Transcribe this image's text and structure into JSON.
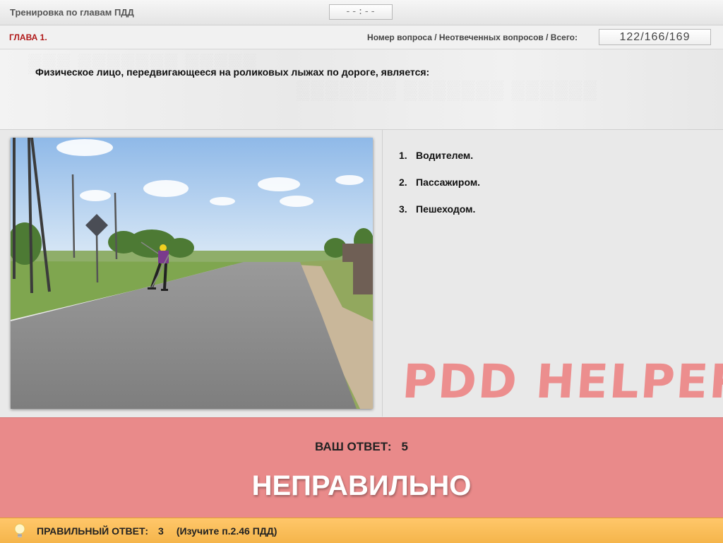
{
  "header": {
    "app_title": "Тренировка по главам ПДД",
    "timer": "--:--"
  },
  "chapter_bar": {
    "chapter": "ГЛАВА 1.",
    "counter_label": "Номер вопроса / Неотвеченных вопросов / Всего:",
    "counter_value": "122/166/169"
  },
  "question": {
    "text": "Физическое лицо, передвигающееся на роликовых лыжах по дороге, является:"
  },
  "answers": [
    {
      "num": "1.",
      "text": "Водителем."
    },
    {
      "num": "2.",
      "text": "Пассажиром."
    },
    {
      "num": "3.",
      "text": "Пешеходом."
    }
  ],
  "watermark": "PDD HELPER",
  "result": {
    "your_answer_label": "ВАШ ОТВЕТ:",
    "your_answer_value": "5",
    "verdict": "НЕПРАВИЛЬНО",
    "color": "#e98a8a"
  },
  "footer": {
    "correct_label": "ПРАВИЛЬНЫЙ ОТВЕТ:",
    "correct_value": "3",
    "hint": "(Изучите п.2.46 ПДД)",
    "color": "#ffc76a",
    "icon": "lightbulb-icon"
  }
}
